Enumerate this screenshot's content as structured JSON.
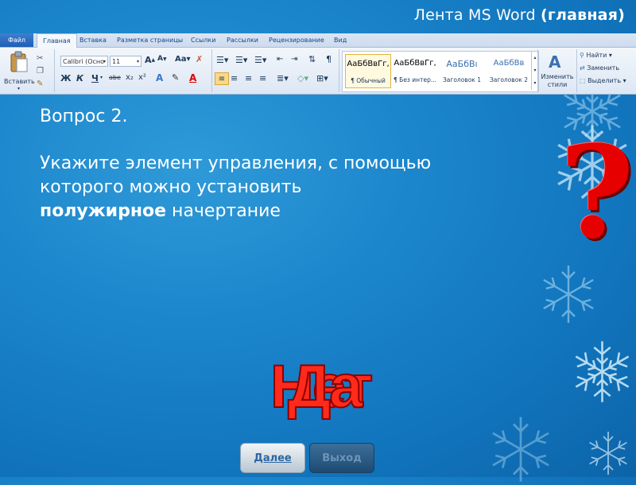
{
  "slide": {
    "title_prefix": "Лента MS Word",
    "title_bold": "(главная)"
  },
  "ribbon": {
    "tabs": [
      "Файл",
      "Главная",
      "Вставка",
      "Разметка страницы",
      "Ссылки",
      "Рассылки",
      "Рецензирование",
      "Вид"
    ],
    "clipboard": {
      "paste_label": "Вставить"
    },
    "font": {
      "name": "Calibri (Осно",
      "size": "11"
    },
    "format_buttons": [
      "Ж",
      "К",
      "Ч",
      "abe",
      "x₂",
      "x²"
    ],
    "styles": [
      {
        "sample": "АаБбВвГг,",
        "name": "¶ Обычный",
        "selected": true
      },
      {
        "sample": "АаБбВвГг,",
        "name": "¶ Без интер...",
        "selected": false
      },
      {
        "sample": "АаБбВı",
        "name": "Заголовок 1",
        "selected": false
      },
      {
        "sample": "АаБбВв",
        "name": "Заголовок 2",
        "selected": false
      }
    ],
    "change_styles": "Изменить стили",
    "editing": {
      "find": "Найти",
      "replace": "Заменить",
      "select": "Выделить"
    }
  },
  "question": {
    "number": "Вопрос 2.",
    "line1": "Укажите элемент управления, с помощью",
    "line2": "которого можно установить",
    "bold_word": "полужирное",
    "rest": " начертание"
  },
  "answer": {
    "yes": "Да",
    "no": "Нет"
  },
  "nav": {
    "next": "Далее",
    "exit": "Выход"
  }
}
